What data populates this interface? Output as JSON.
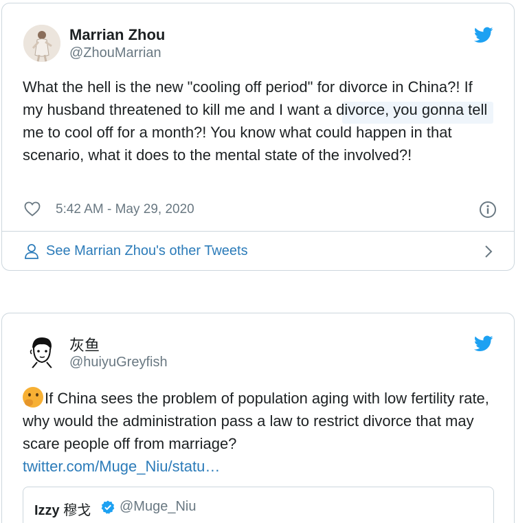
{
  "tweets": [
    {
      "author_name": "Marrian Zhou",
      "author_handle": "@ZhouMarrian",
      "text": "What the hell is the new \"cooling off period\" for divorce in China?! If my husband threatened to kill me and I want a divorce, you gonna tell me to cool off for a month?! You know what could happen in that scenario, what it does to the mental state of the involved?!",
      "timestamp": "5:42 AM - May 29, 2020",
      "see_more": "See Marrian Zhou's other Tweets"
    },
    {
      "author_name": "灰鱼",
      "author_handle": "@huiyuGreyfish",
      "text": "If China sees the problem of population aging with low fertility rate, why would the administration pass a law to restrict divorce that may scare people off from marriage?",
      "link": "twitter.com/Muge_Niu/statu…",
      "emoji": "thinking-face",
      "quote": {
        "name": "Izzy",
        "name_cjk": "穆戈",
        "handle": "@Muge_Niu"
      }
    }
  ],
  "colors": {
    "link": "#2b7bb9",
    "twitter_blue": "#1da1f2",
    "muted": "#697882",
    "border": "#ccd6dd"
  },
  "icons": [
    "twitter-bird-icon",
    "heart-icon",
    "info-icon",
    "user-icon",
    "chevron-right-icon",
    "verified-icon",
    "thinking-face-emoji"
  ]
}
